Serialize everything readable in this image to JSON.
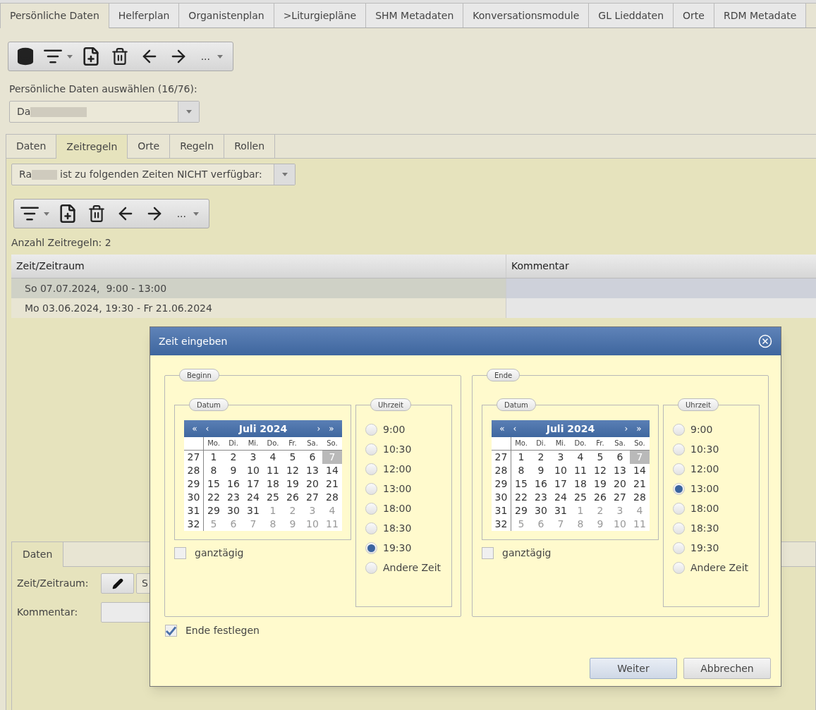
{
  "main_tabs": [
    {
      "label": "Persönliche Daten",
      "selected": true
    },
    {
      "label": "Helferplan",
      "selected": false
    },
    {
      "label": "Organistenplan",
      "selected": false
    },
    {
      "label": ">Liturgiepläne",
      "selected": false
    },
    {
      "label": "SHM Metadaten",
      "selected": false
    },
    {
      "label": "Konversationsmodule",
      "selected": false
    },
    {
      "label": "GL Lieddaten",
      "selected": false
    },
    {
      "label": "Orte",
      "selected": false
    },
    {
      "label": "RDM Metadate",
      "selected": false
    }
  ],
  "toolbar": {
    "more_label": "..."
  },
  "person_select": {
    "label": "Persönliche Daten auswählen (16/76):",
    "value": "Da"
  },
  "inner_tabs": [
    {
      "label": "Daten",
      "selected": false
    },
    {
      "label": "Zeitregeln",
      "selected": true
    },
    {
      "label": "Orte",
      "selected": false
    },
    {
      "label": "Regeln",
      "selected": false
    },
    {
      "label": "Rollen",
      "selected": false
    }
  ],
  "availability_select": {
    "value_start": "Ra",
    "value_rest": "ist zu folgenden Zeiten NICHT verfügbar:"
  },
  "rules_toolbar": {
    "more_label": "..."
  },
  "rule_count": "Anzahl Zeitregeln: 2",
  "table": {
    "columns": [
      "Zeit/Zeitraum",
      "Kommentar"
    ],
    "rows": [
      {
        "cells": [
          "So 07.07.2024,  9:00 - 13:00",
          ""
        ],
        "selected": true
      },
      {
        "cells": [
          "Mo 03.06.2024, 19:30 - Fr 21.06.2024",
          ""
        ],
        "selected": false
      }
    ]
  },
  "detail_panel": {
    "tabs": [
      {
        "label": "Daten",
        "selected": true
      }
    ],
    "time_label": "Zeit/Zeitraum:",
    "time_value": "S",
    "comment_label": "Kommentar:"
  },
  "dialog": {
    "title": "Zeit eingeben",
    "sections": [
      {
        "legend": "Beginn",
        "date_legend": "Datum",
        "time_legend": "Uhrzeit",
        "month": "Juli 2024",
        "nav": [
          "«",
          "‹",
          "›",
          "»"
        ],
        "weekdays": [
          "Mo.",
          "Di.",
          "Mi.",
          "Do.",
          "Fr.",
          "Sa.",
          "So."
        ],
        "weeks": [
          {
            "number": "27",
            "days": [
              {
                "day": "1",
                "other_month": false,
                "selected": false
              },
              {
                "day": "2",
                "other_month": false,
                "selected": false
              },
              {
                "day": "3",
                "other_month": false,
                "selected": false
              },
              {
                "day": "4",
                "other_month": false,
                "selected": false
              },
              {
                "day": "5",
                "other_month": false,
                "selected": false
              },
              {
                "day": "6",
                "other_month": false,
                "selected": false
              },
              {
                "day": "7",
                "other_month": false,
                "selected": true
              }
            ]
          },
          {
            "number": "28",
            "days": [
              {
                "day": "8",
                "other_month": false,
                "selected": false
              },
              {
                "day": "9",
                "other_month": false,
                "selected": false
              },
              {
                "day": "10",
                "other_month": false,
                "selected": false
              },
              {
                "day": "11",
                "other_month": false,
                "selected": false
              },
              {
                "day": "12",
                "other_month": false,
                "selected": false
              },
              {
                "day": "13",
                "other_month": false,
                "selected": false
              },
              {
                "day": "14",
                "other_month": false,
                "selected": false
              }
            ]
          },
          {
            "number": "29",
            "days": [
              {
                "day": "15",
                "other_month": false,
                "selected": false
              },
              {
                "day": "16",
                "other_month": false,
                "selected": false
              },
              {
                "day": "17",
                "other_month": false,
                "selected": false
              },
              {
                "day": "18",
                "other_month": false,
                "selected": false
              },
              {
                "day": "19",
                "other_month": false,
                "selected": false
              },
              {
                "day": "20",
                "other_month": false,
                "selected": false
              },
              {
                "day": "21",
                "other_month": false,
                "selected": false
              }
            ]
          },
          {
            "number": "30",
            "days": [
              {
                "day": "22",
                "other_month": false,
                "selected": false
              },
              {
                "day": "23",
                "other_month": false,
                "selected": false
              },
              {
                "day": "24",
                "other_month": false,
                "selected": false
              },
              {
                "day": "25",
                "other_month": false,
                "selected": false
              },
              {
                "day": "26",
                "other_month": false,
                "selected": false
              },
              {
                "day": "27",
                "other_month": false,
                "selected": false
              },
              {
                "day": "28",
                "other_month": false,
                "selected": false
              }
            ]
          },
          {
            "number": "31",
            "days": [
              {
                "day": "29",
                "other_month": false,
                "selected": false
              },
              {
                "day": "30",
                "other_month": false,
                "selected": false
              },
              {
                "day": "31",
                "other_month": false,
                "selected": false
              },
              {
                "day": "1",
                "other_month": true,
                "selected": false
              },
              {
                "day": "2",
                "other_month": true,
                "selected": false
              },
              {
                "day": "3",
                "other_month": true,
                "selected": false
              },
              {
                "day": "4",
                "other_month": true,
                "selected": false
              }
            ]
          },
          {
            "number": "32",
            "days": [
              {
                "day": "5",
                "other_month": true,
                "selected": false
              },
              {
                "day": "6",
                "other_month": true,
                "selected": false
              },
              {
                "day": "7",
                "other_month": true,
                "selected": false
              },
              {
                "day": "8",
                "other_month": true,
                "selected": false
              },
              {
                "day": "9",
                "other_month": true,
                "selected": false
              },
              {
                "day": "10",
                "other_month": true,
                "selected": false
              },
              {
                "day": "11",
                "other_month": true,
                "selected": false
              }
            ]
          }
        ],
        "times": [
          {
            "label": "9:00",
            "selected": false
          },
          {
            "label": "10:30",
            "selected": false
          },
          {
            "label": "12:00",
            "selected": false
          },
          {
            "label": "13:00",
            "selected": false
          },
          {
            "label": "18:00",
            "selected": false
          },
          {
            "label": "18:30",
            "selected": false
          },
          {
            "label": "19:30",
            "selected": true
          },
          {
            "label": "Andere Zeit",
            "selected": false
          }
        ],
        "all_day": {
          "label": "ganztägig",
          "checked": false
        }
      },
      {
        "legend": "Ende",
        "date_legend": "Datum",
        "time_legend": "Uhrzeit",
        "month": "Juli 2024",
        "nav": [
          "«",
          "‹",
          "›",
          "»"
        ],
        "weekdays": [
          "Mo.",
          "Di.",
          "Mi.",
          "Do.",
          "Fr.",
          "Sa.",
          "So."
        ],
        "weeks": [
          {
            "number": "27",
            "days": [
              {
                "day": "1",
                "other_month": false,
                "selected": false
              },
              {
                "day": "2",
                "other_month": false,
                "selected": false
              },
              {
                "day": "3",
                "other_month": false,
                "selected": false
              },
              {
                "day": "4",
                "other_month": false,
                "selected": false
              },
              {
                "day": "5",
                "other_month": false,
                "selected": false
              },
              {
                "day": "6",
                "other_month": false,
                "selected": false
              },
              {
                "day": "7",
                "other_month": false,
                "selected": true
              }
            ]
          },
          {
            "number": "28",
            "days": [
              {
                "day": "8",
                "other_month": false,
                "selected": false
              },
              {
                "day": "9",
                "other_month": false,
                "selected": false
              },
              {
                "day": "10",
                "other_month": false,
                "selected": false
              },
              {
                "day": "11",
                "other_month": false,
                "selected": false
              },
              {
                "day": "12",
                "other_month": false,
                "selected": false
              },
              {
                "day": "13",
                "other_month": false,
                "selected": false
              },
              {
                "day": "14",
                "other_month": false,
                "selected": false
              }
            ]
          },
          {
            "number": "29",
            "days": [
              {
                "day": "15",
                "other_month": false,
                "selected": false
              },
              {
                "day": "16",
                "other_month": false,
                "selected": false
              },
              {
                "day": "17",
                "other_month": false,
                "selected": false
              },
              {
                "day": "18",
                "other_month": false,
                "selected": false
              },
              {
                "day": "19",
                "other_month": false,
                "selected": false
              },
              {
                "day": "20",
                "other_month": false,
                "selected": false
              },
              {
                "day": "21",
                "other_month": false,
                "selected": false
              }
            ]
          },
          {
            "number": "30",
            "days": [
              {
                "day": "22",
                "other_month": false,
                "selected": false
              },
              {
                "day": "23",
                "other_month": false,
                "selected": false
              },
              {
                "day": "24",
                "other_month": false,
                "selected": false
              },
              {
                "day": "25",
                "other_month": false,
                "selected": false
              },
              {
                "day": "26",
                "other_month": false,
                "selected": false
              },
              {
                "day": "27",
                "other_month": false,
                "selected": false
              },
              {
                "day": "28",
                "other_month": false,
                "selected": false
              }
            ]
          },
          {
            "number": "31",
            "days": [
              {
                "day": "29",
                "other_month": false,
                "selected": false
              },
              {
                "day": "30",
                "other_month": false,
                "selected": false
              },
              {
                "day": "31",
                "other_month": false,
                "selected": false
              },
              {
                "day": "1",
                "other_month": true,
                "selected": false
              },
              {
                "day": "2",
                "other_month": true,
                "selected": false
              },
              {
                "day": "3",
                "other_month": true,
                "selected": false
              },
              {
                "day": "4",
                "other_month": true,
                "selected": false
              }
            ]
          },
          {
            "number": "32",
            "days": [
              {
                "day": "5",
                "other_month": true,
                "selected": false
              },
              {
                "day": "6",
                "other_month": true,
                "selected": false
              },
              {
                "day": "7",
                "other_month": true,
                "selected": false
              },
              {
                "day": "8",
                "other_month": true,
                "selected": false
              },
              {
                "day": "9",
                "other_month": true,
                "selected": false
              },
              {
                "day": "10",
                "other_month": true,
                "selected": false
              },
              {
                "day": "11",
                "other_month": true,
                "selected": false
              }
            ]
          }
        ],
        "times": [
          {
            "label": "9:00",
            "selected": false
          },
          {
            "label": "10:30",
            "selected": false
          },
          {
            "label": "12:00",
            "selected": false
          },
          {
            "label": "13:00",
            "selected": true
          },
          {
            "label": "18:00",
            "selected": false
          },
          {
            "label": "18:30",
            "selected": false
          },
          {
            "label": "19:30",
            "selected": false
          },
          {
            "label": "Andere Zeit",
            "selected": false
          }
        ],
        "all_day": {
          "label": "ganztägig",
          "checked": false
        }
      }
    ],
    "set_end": {
      "label": "Ende festlegen",
      "checked": true
    },
    "buttons": [
      "Weiter",
      "Abbrechen"
    ]
  }
}
